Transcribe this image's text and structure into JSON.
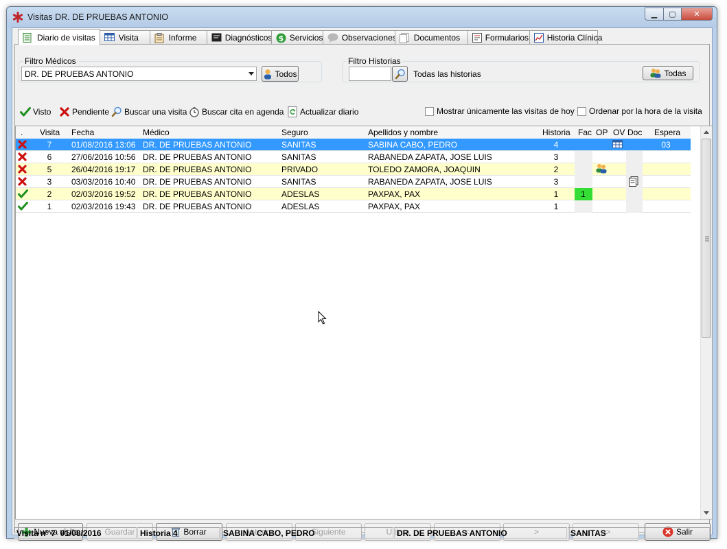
{
  "window": {
    "title": "Visitas DR. DE PRUEBAS ANTONIO",
    "min_glyph": "▁",
    "max_glyph": "▢",
    "close_glyph": "✕"
  },
  "tabs": [
    {
      "label": "Diario de visitas",
      "icon": "list-icon",
      "active": true
    },
    {
      "label": "Visita",
      "icon": "grid-icon"
    },
    {
      "label": "Informe",
      "icon": "clipboard-icon"
    },
    {
      "label": "Diagnósticos",
      "icon": "monitor-icon"
    },
    {
      "label": "Servicios",
      "icon": "dollar-icon"
    },
    {
      "label": "Observaciones",
      "icon": "speech-bubble-icon"
    },
    {
      "label": "Documentos",
      "icon": "documents-icon"
    },
    {
      "label": "Formularios",
      "icon": "form-icon"
    },
    {
      "label": "Historia Clínica",
      "icon": "chart-icon"
    }
  ],
  "filtro_medicos": {
    "label": "Filtro Médicos",
    "selected": "DR. DE PRUEBAS ANTONIO",
    "todos_label": "Todos"
  },
  "filtro_historias": {
    "label": "Filtro Historias",
    "value": "",
    "status": "Todas las historias",
    "todas_label": "Todas"
  },
  "toolbar": {
    "visto": "Visto",
    "pendiente": "Pendiente",
    "buscar_visita": "Buscar una visita",
    "buscar_cita": "Buscar cita en agenda",
    "actualizar": "Actualizar diario",
    "mostrar_hoy": "Mostrar únicamente las visitas de hoy",
    "ordenar_hora": "Ordenar por la hora de la visita"
  },
  "columns": {
    "dot": ".",
    "visita": "Visita",
    "fecha": "Fecha",
    "medico": "Médico",
    "seguro": "Seguro",
    "nombre": "Apellidos y nombre",
    "historia": "Historia",
    "fac": "Fac",
    "op": "OP",
    "ov": "OV",
    "doc": "Doc",
    "espera": "Espera"
  },
  "rows": [
    {
      "status": "pendiente",
      "visita": "7",
      "fecha": "01/08/2016 13:06",
      "medico": "DR. DE PRUEBAS ANTONIO",
      "seguro": "SANITAS",
      "nombre": "SABINA CABO, PEDRO",
      "historia": "4",
      "fac": "",
      "op": "",
      "ov": "grid-icon",
      "doc": "",
      "espera": "03",
      "style": "selected"
    },
    {
      "status": "pendiente",
      "visita": "6",
      "fecha": "27/06/2016 10:56",
      "medico": "DR. DE PRUEBAS ANTONIO",
      "seguro": "SANITAS",
      "nombre": "RABANEDA ZAPATA, JOSE LUIS",
      "historia": "3",
      "fac": "",
      "op": "",
      "ov": "",
      "doc": "",
      "espera": "",
      "style": ""
    },
    {
      "status": "pendiente",
      "visita": "5",
      "fecha": "26/04/2016 19:17",
      "medico": "DR. DE PRUEBAS ANTONIO",
      "seguro": "PRIVADO",
      "nombre": "TOLEDO ZAMORA, JOAQUIN",
      "historia": "2",
      "fac": "",
      "op": "users-icon",
      "ov": "",
      "doc": "",
      "espera": "",
      "style": "yellow"
    },
    {
      "status": "pendiente",
      "visita": "3",
      "fecha": "03/03/2016 10:40",
      "medico": "DR. DE PRUEBAS ANTONIO",
      "seguro": "SANITAS",
      "nombre": "RABANEDA ZAPATA, JOSE LUIS",
      "historia": "3",
      "fac": "",
      "op": "",
      "ov": "",
      "doc": "documents-icon",
      "espera": "",
      "style": ""
    },
    {
      "status": "visto",
      "visita": "2",
      "fecha": "02/03/2016 19:52",
      "medico": "DR. DE PRUEBAS ANTONIO",
      "seguro": "ADESLAS",
      "nombre": "PAXPAX, PAX",
      "historia": "1",
      "fac": "1",
      "op": "",
      "ov": "",
      "doc": "",
      "espera": "",
      "style": "yellow"
    },
    {
      "status": "visto",
      "visita": "1",
      "fecha": "02/03/2016 19:43",
      "medico": "DR. DE PRUEBAS ANTONIO",
      "seguro": "ADESLAS",
      "nombre": "PAXPAX, PAX",
      "historia": "1",
      "fac": "",
      "op": "",
      "ov": "",
      "doc": "",
      "espera": "",
      "style": ""
    }
  ],
  "navbar": {
    "nueva": "Nueva visita",
    "guardar": "Guardar",
    "borrar": "Borrar",
    "anterior": "Anterior",
    "siguiente": "Siguiente",
    "ultima": "Ultima",
    "prev": "<",
    "next": ">",
    "last": ">>",
    "salir": "Salir"
  },
  "statusbar": {
    "visita": "Visita nº 7  01/08/2016",
    "historia": "Historia 4",
    "paciente": "SABINA CABO, PEDRO",
    "medico": "DR. DE PRUEBAS ANTONIO",
    "seguro": "SANITAS"
  },
  "colors": {
    "selected_row": "#3399ff",
    "yellow_row": "#ffffcc",
    "fac_green": "#33dd33",
    "check_green": "#1e8f1e",
    "cross_red": "#cc1111"
  }
}
